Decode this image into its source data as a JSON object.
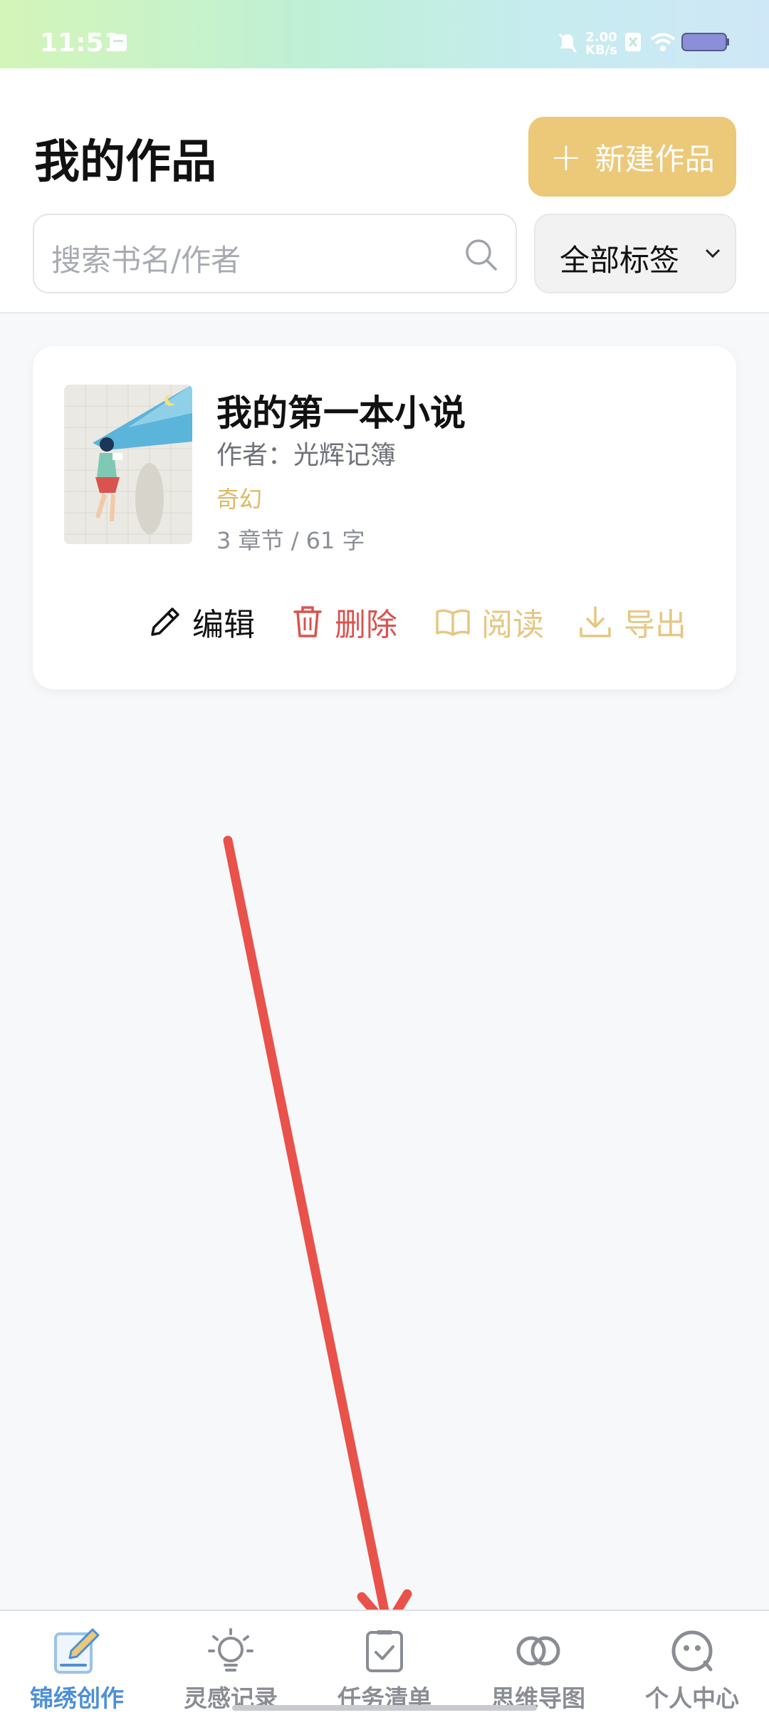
{
  "status_bar": {
    "time": "11:51",
    "net_speed_value": "2.00",
    "net_speed_unit": "KB/s"
  },
  "header": {
    "title": "我的作品",
    "new_button_label": "新建作品",
    "search_placeholder": "搜索书名/作者",
    "tag_filter_label": "全部标签"
  },
  "works": [
    {
      "title": "我的第一本小说",
      "author": "作者：光辉记簿",
      "tag": "奇幻",
      "stats": "3 章节 / 61 字",
      "actions": {
        "edit": "编辑",
        "delete": "删除",
        "read": "阅读",
        "export": "导出"
      }
    }
  ],
  "bottom_nav": [
    {
      "label": "锦绣创作",
      "icon": "edit-note-icon",
      "active": true
    },
    {
      "label": "灵感记录",
      "icon": "lightbulb-icon",
      "active": false
    },
    {
      "label": "任务清单",
      "icon": "checklist-icon",
      "active": false
    },
    {
      "label": "思维导图",
      "icon": "rings-icon",
      "active": false
    },
    {
      "label": "个人中心",
      "icon": "smiley-icon",
      "active": false
    }
  ],
  "colors": {
    "accent_gold": "#ecc879",
    "active_blue": "#4e8fd6",
    "delete_red": "#d9534f",
    "annotation_arrow": "#e8524a"
  }
}
